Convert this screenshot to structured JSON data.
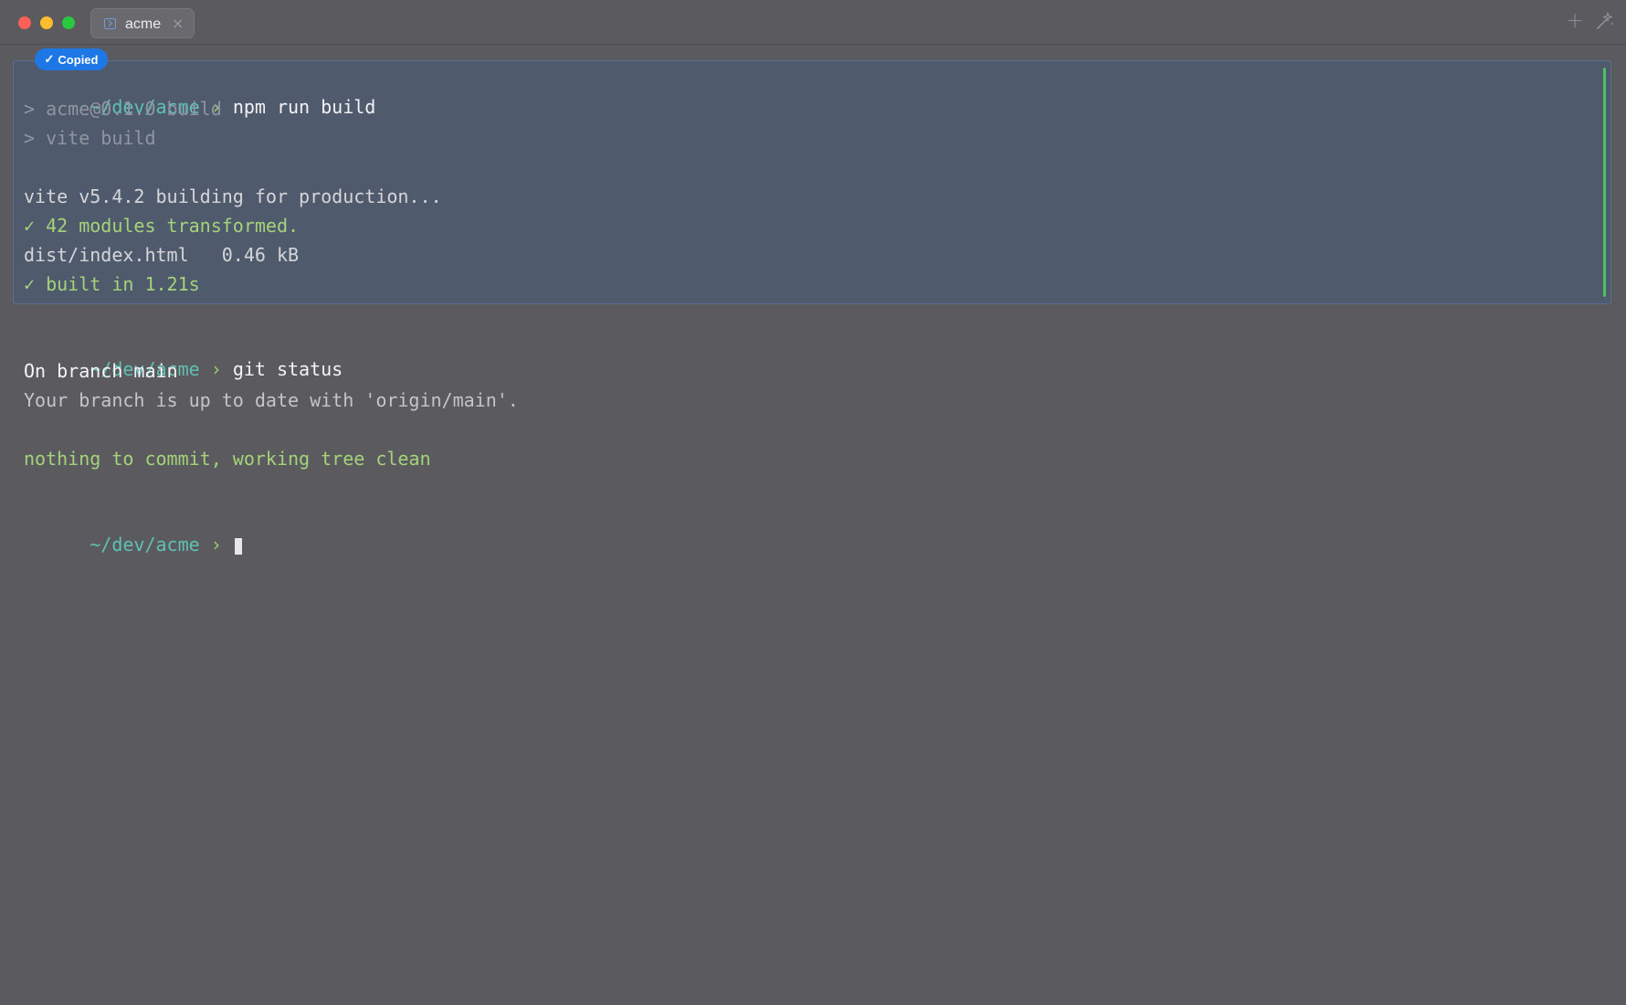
{
  "window": {
    "tab": {
      "label": "acme",
      "close_glyph": "×",
      "icon": "terminal-icon"
    },
    "new_tab_glyph": "+",
    "colors": {
      "close": "#ff5f57",
      "minimize": "#febc2e",
      "maximize": "#28c840",
      "accent": "#1d78e6",
      "success": "#4cc15e"
    }
  },
  "badge": {
    "check": "✓",
    "label": "Copied"
  },
  "prompt": {
    "path": "~/dev/acme",
    "arrow": "›"
  },
  "block1": {
    "command": "npm run build",
    "lines": [
      "> acme@0.1.0 build",
      "> vite build",
      "vite v5.4.2 building for production...",
      "✓ 42 modules transformed.",
      "dist/index.html   0.46 kB",
      "✓ built in 1.21s"
    ]
  },
  "block2": {
    "command": "git status",
    "lines": [
      "On branch main",
      "Your branch is up to date with 'origin/main'.",
      "nothing to commit, working tree clean"
    ]
  }
}
